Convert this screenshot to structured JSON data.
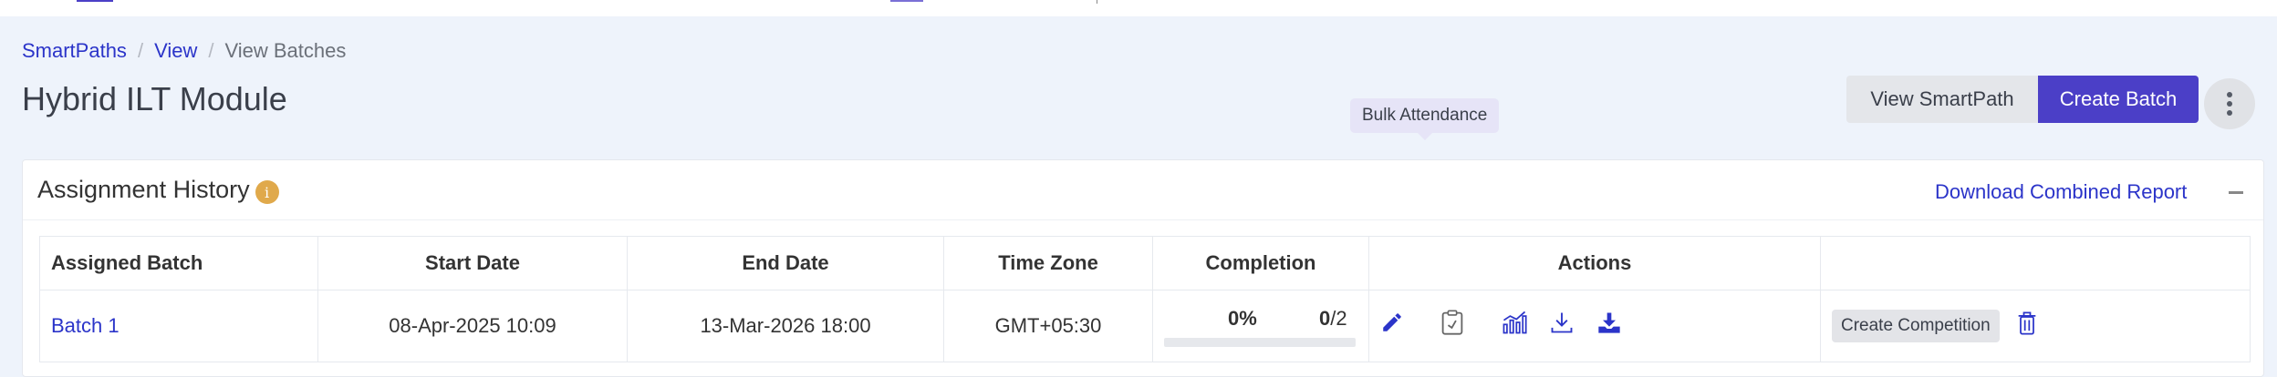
{
  "breadcrumb": {
    "items": [
      "SmartPaths",
      "View"
    ],
    "separator": "/",
    "current": "View Batches"
  },
  "page": {
    "title": "Hybrid ILT Module",
    "view_smartpath_label": "View SmartPath",
    "create_batch_label": "Create Batch"
  },
  "card": {
    "title": "Assignment History",
    "info_icon_glyph": "i",
    "download_label": "Download Combined Report"
  },
  "table": {
    "headers": [
      "Assigned Batch",
      "Start Date",
      "End Date",
      "Time Zone",
      "Completion",
      "Actions",
      ""
    ],
    "rows": [
      {
        "batch": "Batch 1",
        "start_date": "08-Apr-2025 10:09",
        "end_date": "13-Mar-2026 18:00",
        "time_zone": "GMT+05:30",
        "completion_pct": "0%",
        "completion_done": "0",
        "completion_total": "/2",
        "progress": 0,
        "create_competition_label": "Create Competition"
      }
    ]
  },
  "tooltip": {
    "text": "Bulk Attendance"
  },
  "icons": {
    "edit": "pencil-icon",
    "bulk_attendance": "clipboard-check-icon",
    "analytics": "chart-icon",
    "download": "download-icon",
    "download_bulk": "download-tray-icon",
    "delete": "trash-icon",
    "more": "vertical-dots-icon",
    "collapse": "minus-icon"
  },
  "colors": {
    "accent": "#4b3fc7",
    "link": "#2b34c9",
    "info": "#e0a94b",
    "background": "#eef3fb"
  }
}
